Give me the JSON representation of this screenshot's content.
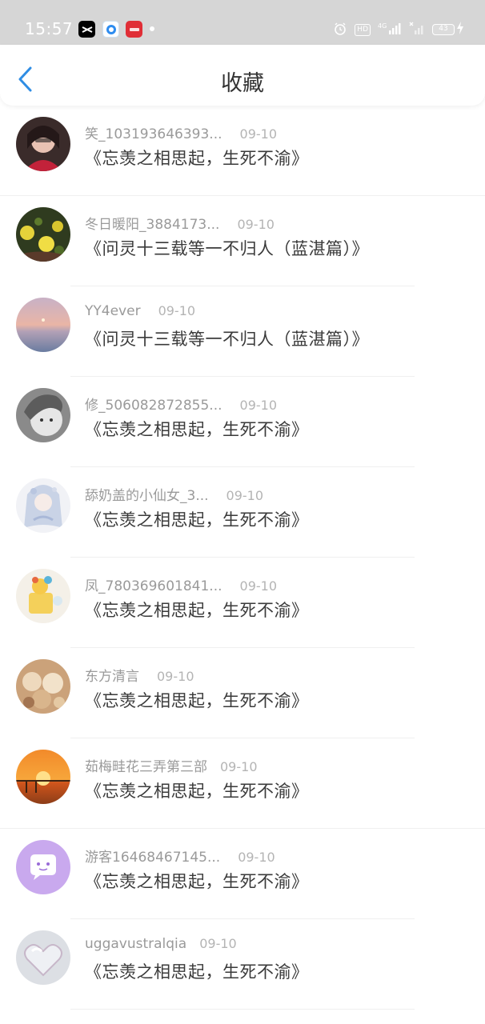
{
  "status_bar": {
    "time": "15:57",
    "network": "4G",
    "battery_level": "43",
    "hd_label": "HD"
  },
  "header": {
    "title": "收藏",
    "back_icon": "chevron-left-icon"
  },
  "list": [
    {
      "username": "笑_103193646393...",
      "date": "09-10",
      "title": "《忘羡之相思起，生死不渝》"
    },
    {
      "username": "冬日暖阳_3884173...",
      "date": "09-10",
      "title": "《问灵十三载等一不归人（蓝湛篇）》"
    },
    {
      "username": "YY4ever",
      "date": "09-10",
      "title": "《问灵十三载等一不归人（蓝湛篇）》"
    },
    {
      "username": "修_506082872855...",
      "date": "09-10",
      "title": "《忘羡之相思起，生死不渝》"
    },
    {
      "username": "舔奶盖的小仙女_3...",
      "date": "09-10",
      "title": "《忘羡之相思起，生死不渝》"
    },
    {
      "username": "凤_780369601841...",
      "date": "09-10",
      "title": "《忘羡之相思起，生死不渝》"
    },
    {
      "username": "东方清言",
      "date": "09-10",
      "title": "《忘羡之相思起，生死不渝》"
    },
    {
      "username": "茹梅畦花三弄第三部",
      "date": "09-10",
      "title": "《忘羡之相思起，生死不渝》"
    },
    {
      "username": "游客16468467145...",
      "date": "09-10",
      "title": "《忘羡之相思起，生死不渝》"
    },
    {
      "username": "uggavustralqia",
      "date": "09-10",
      "title": "《忘羡之相思起，生死不渝》"
    }
  ],
  "colors": {
    "accent": "#2f8de4",
    "status_bar": "#d6d6d6",
    "username": "#9a9a9a",
    "title": "#3a3a3a"
  }
}
